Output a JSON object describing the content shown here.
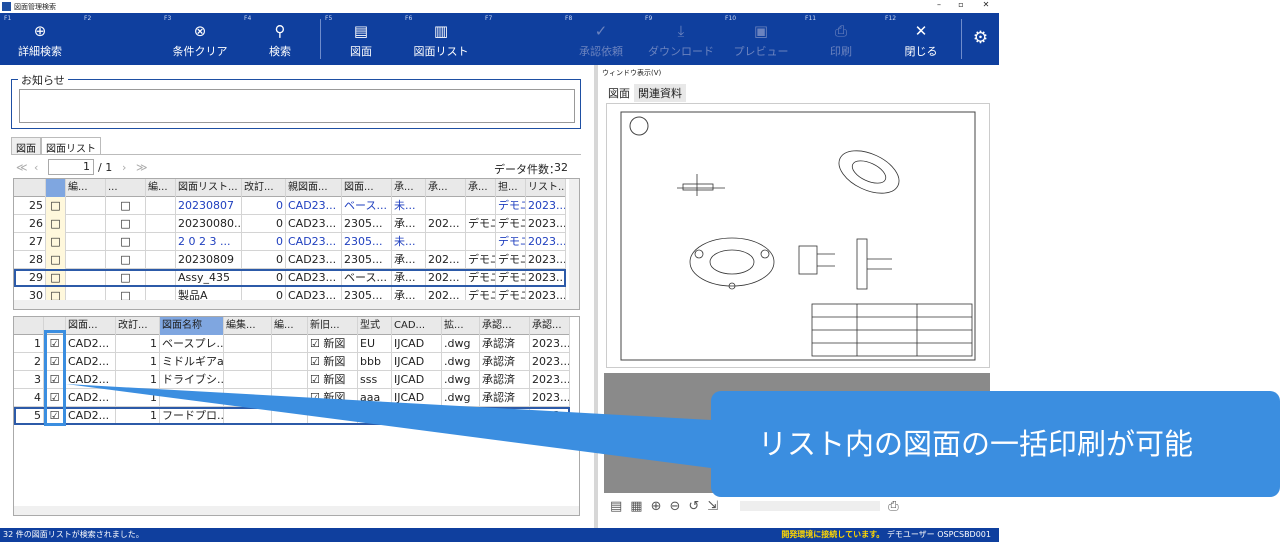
{
  "window": {
    "title": "図面管理検索",
    "min": "–",
    "max": "▫",
    "close": "✕"
  },
  "toolbar": [
    {
      "fk": "F1",
      "label": "詳細検索",
      "icon": "⊕"
    },
    {
      "fk": "F2",
      "label": "",
      "icon": ""
    },
    {
      "fk": "F3",
      "label": "条件クリア",
      "icon": "⊗"
    },
    {
      "fk": "F4",
      "label": "検索",
      "icon": "⚲"
    },
    {
      "fk": "F5",
      "label": "図面",
      "icon": "▤"
    },
    {
      "fk": "F6",
      "label": "図面リスト",
      "icon": "▥"
    },
    {
      "fk": "F7",
      "label": "",
      "icon": ""
    },
    {
      "fk": "F8",
      "label": "承認依頼",
      "icon": "✓"
    },
    {
      "fk": "F9",
      "label": "ダウンロード",
      "icon": "⤓"
    },
    {
      "fk": "F10",
      "label": "プレビュー",
      "icon": "▣"
    },
    {
      "fk": "F11",
      "label": "印刷",
      "icon": "⎙"
    },
    {
      "fk": "F12",
      "label": "閉じる",
      "icon": "✕"
    }
  ],
  "settings_icon": "⚙",
  "notice": {
    "legend": "お知らせ"
  },
  "tabs": [
    "図面",
    "図面リスト"
  ],
  "pager": {
    "first": "≪",
    "prev": "‹",
    "page": "1",
    "total": "/ 1",
    "next": "›",
    "last": "≫",
    "count_label": "データ件数：",
    "count": "32"
  },
  "upper_grid": {
    "headers": [
      "",
      "",
      "編...",
      "...",
      "編...",
      "図面リスト...",
      "改訂...",
      "親図面...",
      "図面...",
      "承...",
      "承...",
      "承...",
      "担...",
      "リスト..."
    ],
    "rows": [
      {
        "no": "25",
        "c1": "□",
        "c3": "□",
        "name": "20230807",
        "rev": "0",
        "parent": "CAD23...",
        "dwg": "ベース...",
        "a1": "未...",
        "a2": "",
        "a3": "",
        "person": "デモユ",
        "list": "2023...",
        "blue": true
      },
      {
        "no": "26",
        "c1": "□",
        "c3": "□",
        "name": "20230080...",
        "rev": "0",
        "parent": "CAD23...",
        "dwg": "2305...",
        "a1": "承...",
        "a2": "202...",
        "a3": "デモユ",
        "person": "デモユ",
        "list": "2023...",
        "blue": false
      },
      {
        "no": "27",
        "c1": "□",
        "c3": "□",
        "name": "2 0 2 3 ...",
        "rev": "0",
        "parent": "CAD23...",
        "dwg": "2305...",
        "a1": "未...",
        "a2": "",
        "a3": "",
        "person": "デモユ",
        "list": "2023...",
        "blue": true
      },
      {
        "no": "28",
        "c1": "□",
        "c3": "□",
        "name": "20230809",
        "rev": "0",
        "parent": "CAD23...",
        "dwg": "2305...",
        "a1": "承...",
        "a2": "202...",
        "a3": "デモユ",
        "person": "デモユ",
        "list": "2023...",
        "blue": false
      },
      {
        "no": "29",
        "c1": "□",
        "c3": "□",
        "name": "Assy_435",
        "rev": "0",
        "parent": "CAD23...",
        "dwg": "ベース...",
        "a1": "承...",
        "a2": "202...",
        "a3": "デモユ",
        "person": "デモユ",
        "list": "2023...",
        "blue": false
      },
      {
        "no": "30",
        "c1": "□",
        "c3": "□",
        "name": "製品A",
        "rev": "0",
        "parent": "CAD23...",
        "dwg": "2305...",
        "a1": "承...",
        "a2": "202...",
        "a3": "デモユ",
        "person": "デモユ",
        "list": "2023...",
        "blue": false
      }
    ]
  },
  "lower_grid": {
    "headers": [
      "",
      "",
      "図面...",
      "改訂...",
      "図面名称",
      "編集...",
      "編...",
      "新旧...",
      "型式",
      "CAD...",
      "拡...",
      "承認...",
      "承認..."
    ],
    "rows": [
      {
        "no": "1",
        "chk": "☑",
        "dwg": "CAD2...",
        "rev": "1",
        "name": "ベースプレ...",
        "newold": "☑ 新図",
        "type": "EU",
        "cad": "IJCAD",
        "ext": ".dwg",
        "appr": "承認済",
        "date": "2023..."
      },
      {
        "no": "2",
        "chk": "☑",
        "dwg": "CAD2...",
        "rev": "1",
        "name": "ミドルギアa",
        "newold": "☑ 新図",
        "type": "bbb",
        "cad": "IJCAD",
        "ext": ".dwg",
        "appr": "承認済",
        "date": "2023..."
      },
      {
        "no": "3",
        "chk": "☑",
        "dwg": "CAD2...",
        "rev": "1",
        "name": "ドライブシ...",
        "newold": "☑ 新図",
        "type": "sss",
        "cad": "IJCAD",
        "ext": ".dwg",
        "appr": "承認済",
        "date": "2023..."
      },
      {
        "no": "4",
        "chk": "☑",
        "dwg": "CAD2...",
        "rev": "1",
        "name": "",
        "newold": "☑ 新図",
        "type": "aaa",
        "cad": "IJCAD",
        "ext": ".dwg",
        "appr": "承認済",
        "date": "2023..."
      },
      {
        "no": "5",
        "chk": "☑",
        "dwg": "CAD2...",
        "rev": "1",
        "name": "フードプロ...",
        "newold": "",
        "type": "",
        "cad": "",
        "ext": "",
        "appr": "承認済",
        "date": "2023..."
      }
    ]
  },
  "preview": {
    "window_label": "ウィンドウ表示(V)",
    "tabs": [
      "図面",
      "関連資料"
    ]
  },
  "status": {
    "left": "32 件の図面リストが検索されました。",
    "right_bold": "開発環境に接続しています。",
    "right": " デモユーザー OSPCSBD001"
  },
  "callout": "リスト内の図面の一括印刷が可能",
  "colors": {
    "toolbar": "#0f3f9e",
    "accent": "#3b8ee0"
  }
}
